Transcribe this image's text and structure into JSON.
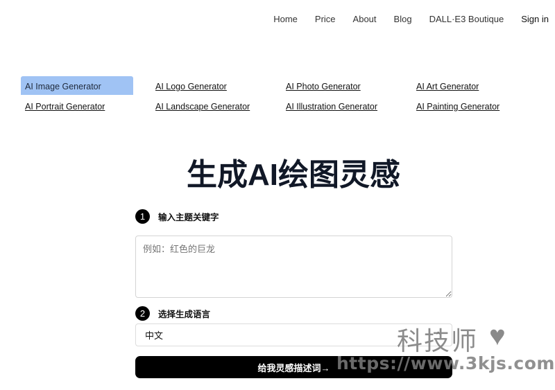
{
  "nav": {
    "items": [
      "Home",
      "Price",
      "About",
      "Blog",
      "DALL·E3 Boutique"
    ],
    "signin": "Sign in"
  },
  "generators": [
    {
      "label": "AI Image Generator",
      "active": true
    },
    {
      "label": "AI Logo Generator",
      "active": false
    },
    {
      "label": "AI Photo Generator",
      "active": false
    },
    {
      "label": "AI Art Generator",
      "active": false
    },
    {
      "label": "AI Portrait Generator",
      "active": false
    },
    {
      "label": "AI Landscape Generator",
      "active": false
    },
    {
      "label": "AI Illustration Generator",
      "active": false
    },
    {
      "label": "AI Painting Generator",
      "active": false
    }
  ],
  "page": {
    "title": "生成AI绘图灵感"
  },
  "form": {
    "step1": {
      "number": "1",
      "label": "输入主题关键字"
    },
    "keyword_placeholder": "例如：红色的巨龙",
    "keyword_value": "",
    "step2": {
      "number": "2",
      "label": "选择生成语言"
    },
    "language_selected": "中文",
    "submit_label": "给我灵感描述词→"
  },
  "watermark": {
    "text": "科技师",
    "url": "https://www.3kjs.com",
    "icon": "heart-icon"
  }
}
